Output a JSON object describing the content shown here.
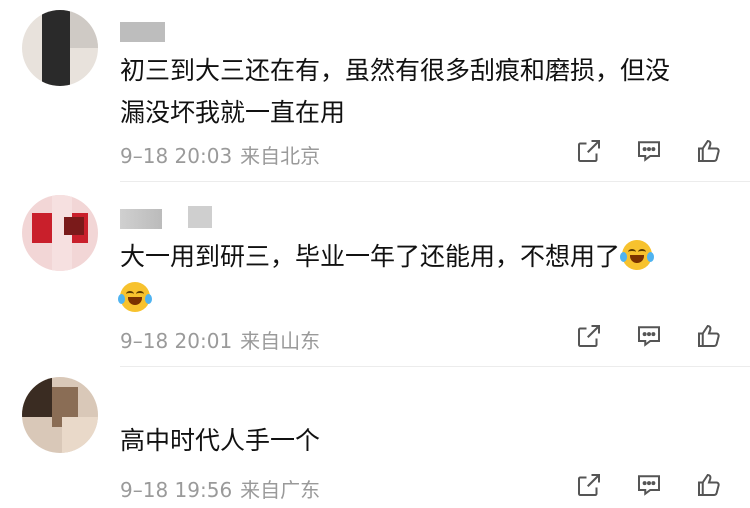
{
  "comments": [
    {
      "text_lines": [
        "初三到大三还在有，虽然有很多刮痕和磨损，但没",
        "漏没坏我就一直在用"
      ],
      "time": "9–18 20:03",
      "location": "来自北京"
    },
    {
      "text_lines": [
        "大一用到研三，毕业一年了还能用，不想用了",
        ""
      ],
      "time": "9–18 20:01",
      "location": "来自山东"
    },
    {
      "text_lines": [
        "高中时代人手一个"
      ],
      "time": "9–18 19:56",
      "location": "来自广东"
    }
  ],
  "icons": {
    "share": "share-icon",
    "comment": "comment-icon",
    "like": "like-icon",
    "emoji": "laugh-cry-emoji"
  },
  "colors": {
    "text": "#111111",
    "meta": "#9a9a9a",
    "icon": "#555555",
    "divider": "#ececec"
  }
}
